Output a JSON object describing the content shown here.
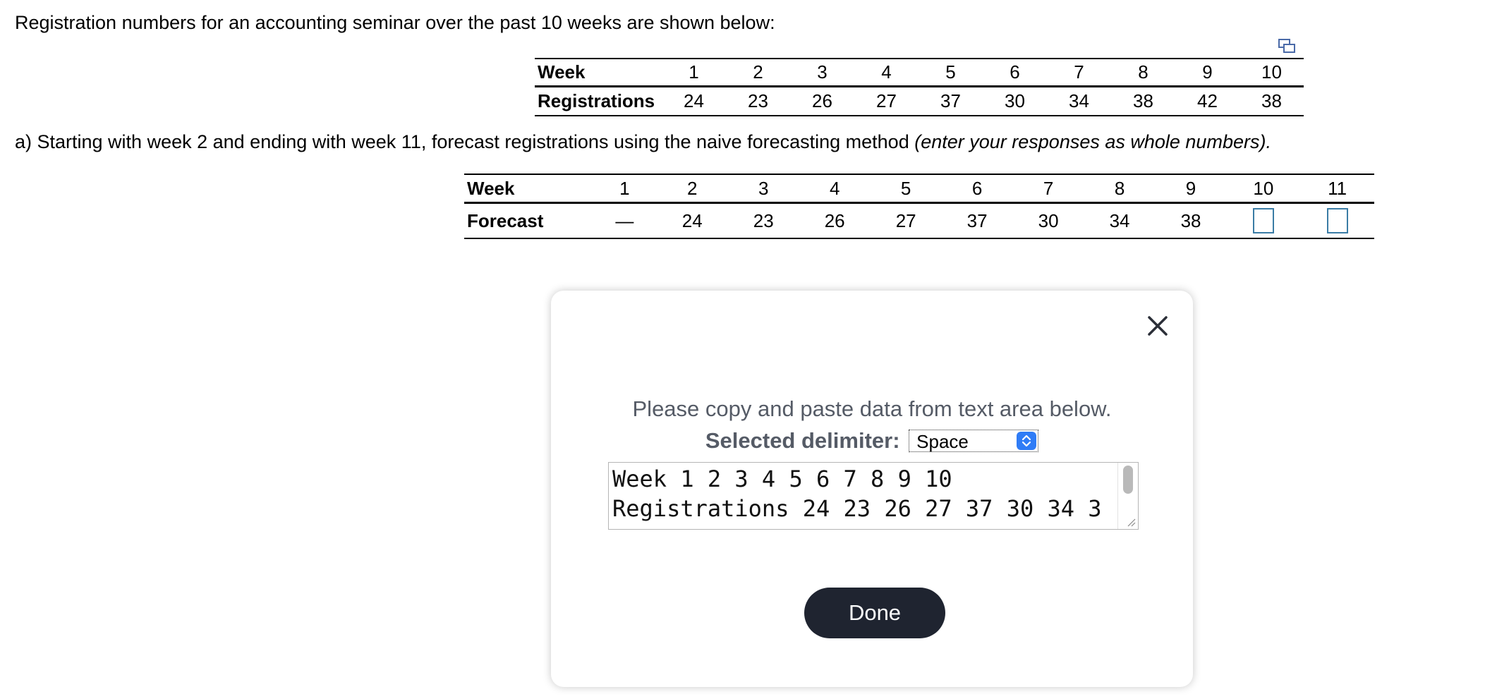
{
  "intro_text": "Registration numbers for an accounting seminar over the past 10 weeks are shown below:",
  "copy_icon": "copy-data-icon",
  "registrations_table": {
    "row1_label": "Week",
    "row2_label": "Registrations",
    "weeks": [
      "1",
      "2",
      "3",
      "4",
      "5",
      "6",
      "7",
      "8",
      "9",
      "10"
    ],
    "registrations": [
      "24",
      "23",
      "26",
      "27",
      "37",
      "30",
      "34",
      "38",
      "42",
      "38"
    ]
  },
  "question": {
    "text": "a) Starting with week 2 and ending with week 11, forecast registrations using the naive forecasting method ",
    "italic": "(enter your responses as whole numbers)."
  },
  "forecast_table": {
    "row1_label": "Week",
    "row2_label": "Forecast",
    "weeks": [
      "1",
      "2",
      "3",
      "4",
      "5",
      "6",
      "7",
      "8",
      "9",
      "10",
      "11"
    ],
    "forecast": [
      "—",
      "24",
      "23",
      "26",
      "27",
      "37",
      "30",
      "34",
      "38"
    ],
    "input_values": [
      "",
      ""
    ]
  },
  "modal": {
    "instruction": "Please copy and paste data from text area below.",
    "delimiter_label": "Selected delimiter:",
    "delimiter_value": "Space",
    "textarea_line1": "Week 1 2 3 4 5 6 7 8 9 10",
    "textarea_line2": "Registrations 24 23 26 27 37 30 34 3",
    "done_label": "Done",
    "accent_color": "#2f7cf6",
    "button_color": "#1f2430"
  }
}
